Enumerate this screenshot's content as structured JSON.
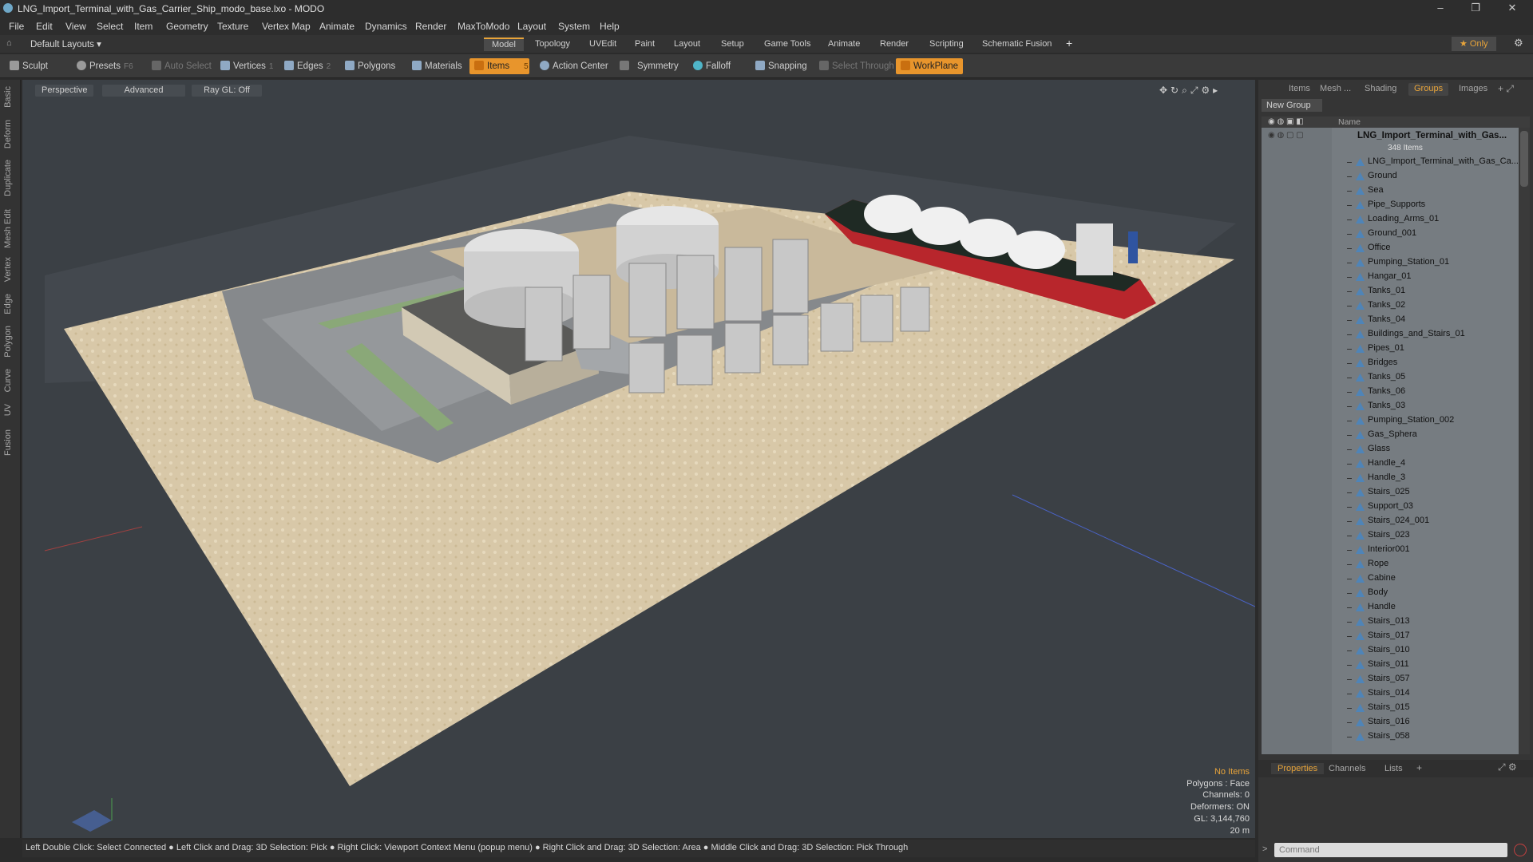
{
  "window": {
    "title": "LNG_Import_Terminal_with_Gas_Carrier_Ship_modo_base.lxo - MODO",
    "min": "–",
    "max": "❐",
    "close": "✕"
  },
  "menu": [
    "File",
    "Edit",
    "View",
    "Select",
    "Item",
    "Geometry",
    "Texture",
    "Vertex Map",
    "Animate",
    "Dynamics",
    "Render",
    "MaxToModo",
    "Layout",
    "System",
    "Help"
  ],
  "layout": {
    "selector": "Default Layouts ▾",
    "tabs": [
      "Model",
      "Topology",
      "UVEdit",
      "Paint",
      "Layout",
      "Setup",
      "Game Tools",
      "Animate",
      "Render",
      "Scripting",
      "Schematic Fusion"
    ],
    "active": "Model",
    "add": "+",
    "only": "★  Only"
  },
  "toolbar": {
    "sculpt": "Sculpt",
    "presets": "Presets",
    "presets_key": "F6",
    "auto_select": "Auto Select",
    "vertices": "Vertices",
    "vertices_n": "1",
    "edges": "Edges",
    "edges_n": "2",
    "polygons": "Polygons",
    "materials": "Materials",
    "items": "Items",
    "items_n": "5",
    "action_center": "Action Center",
    "symmetry": "Symmetry",
    "falloff": "Falloff",
    "snapping": "Snapping",
    "select_through": "Select Through",
    "workplane": "WorkPlane"
  },
  "left_tabs": [
    "Basic",
    "Deform",
    "Duplicate",
    "Mesh Edit",
    "Vertex",
    "Edge",
    "Polygon",
    "Curve",
    "UV",
    "Fusion"
  ],
  "viewport": {
    "perspective": "Perspective",
    "advanced": "Advanced",
    "raygl": "Ray GL: Off",
    "info": {
      "items": "No Items",
      "polygons": "Polygons : Face",
      "channels": "Channels: 0",
      "deformers": "Deformers: ON",
      "gl": "GL: 3,144,760",
      "scale": "20 m"
    }
  },
  "status": "Left Double Click: Select Connected ● Left Click and Drag: 3D Selection: Pick ● Right Click: Viewport Context Menu (popup menu) ● Right Click and Drag: 3D Selection: Area ● Middle Click and Drag: 3D Selection: Pick Through",
  "right_panel": {
    "tabs": [
      "Items",
      "Mesh ...",
      "Shading",
      "Groups",
      "Images"
    ],
    "active_tab": "Groups",
    "new_group": "New Group",
    "col_name": "Name",
    "root": "LNG_Import_Terminal_with_Gas...",
    "root_count": "348 Items",
    "items": [
      "LNG_Import_Terminal_with_Gas_Ca...",
      "Ground",
      "Sea",
      "Pipe_Supports",
      "Loading_Arms_01",
      "Ground_001",
      "Office",
      "Pumping_Station_01",
      "Hangar_01",
      "Tanks_01",
      "Tanks_02",
      "Tanks_04",
      "Buildings_and_Stairs_01",
      "Pipes_01",
      "Bridges",
      "Tanks_05",
      "Tanks_06",
      "Tanks_03",
      "Pumping_Station_002",
      "Gas_Sphera",
      "Glass",
      "Handle_4",
      "Handle_3",
      "Stairs_025",
      "Support_03",
      "Stairs_024_001",
      "Stairs_023",
      "Interior001",
      "Rope",
      "Cabine",
      "Body",
      "Handle",
      "Stairs_013",
      "Stairs_017",
      "Stairs_010",
      "Stairs_011",
      "Stairs_057",
      "Stairs_014",
      "Stairs_015",
      "Stairs_016",
      "Stairs_058"
    ],
    "bottom_tabs": [
      "Properties",
      "Channels",
      "Lists"
    ],
    "bottom_active": "Properties",
    "command_placeholder": "Command"
  },
  "colors": {
    "accent": "#e8952c",
    "list_bg": "#767c81",
    "viewport_bg": "#3b4045"
  }
}
